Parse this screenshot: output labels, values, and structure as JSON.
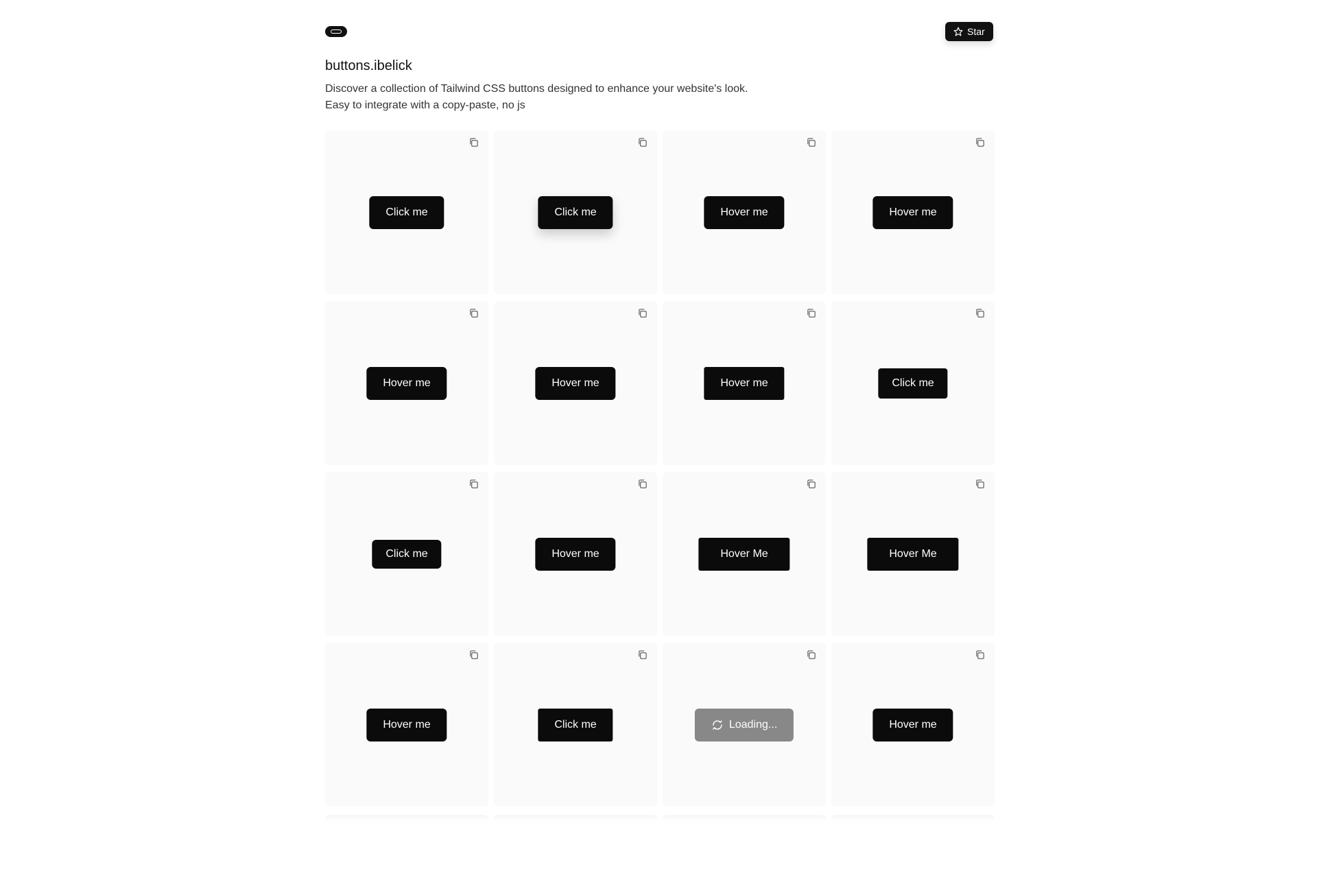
{
  "header": {
    "star_label": "Star"
  },
  "hero": {
    "title": "buttons.ibelick",
    "description_line1": "Discover a collection of Tailwind CSS buttons designed to enhance your website's look.",
    "description_line2": "Easy to integrate with a copy-paste, no js"
  },
  "cards": [
    {
      "label": "Click me"
    },
    {
      "label": "Click me"
    },
    {
      "label": "Hover me"
    },
    {
      "label": "Hover me"
    },
    {
      "label": "Hover me"
    },
    {
      "label": "Hover me"
    },
    {
      "label": "Hover me"
    },
    {
      "label": "Click me"
    },
    {
      "label": "Click me"
    },
    {
      "label": "Hover me"
    },
    {
      "label": "Hover Me"
    },
    {
      "label": "Hover Me"
    },
    {
      "label": "Hover me"
    },
    {
      "label": "Click me"
    },
    {
      "label": "Loading..."
    },
    {
      "label": "Hover me"
    }
  ],
  "icons": {
    "logo": "button-logo-icon",
    "star": "star-icon",
    "copy": "copy-icon",
    "loading": "refresh-spinner-icon"
  },
  "colors": {
    "button_bg": "#0b0b0b",
    "card_bg": "#fafafa",
    "loading_bg": "#888888"
  }
}
